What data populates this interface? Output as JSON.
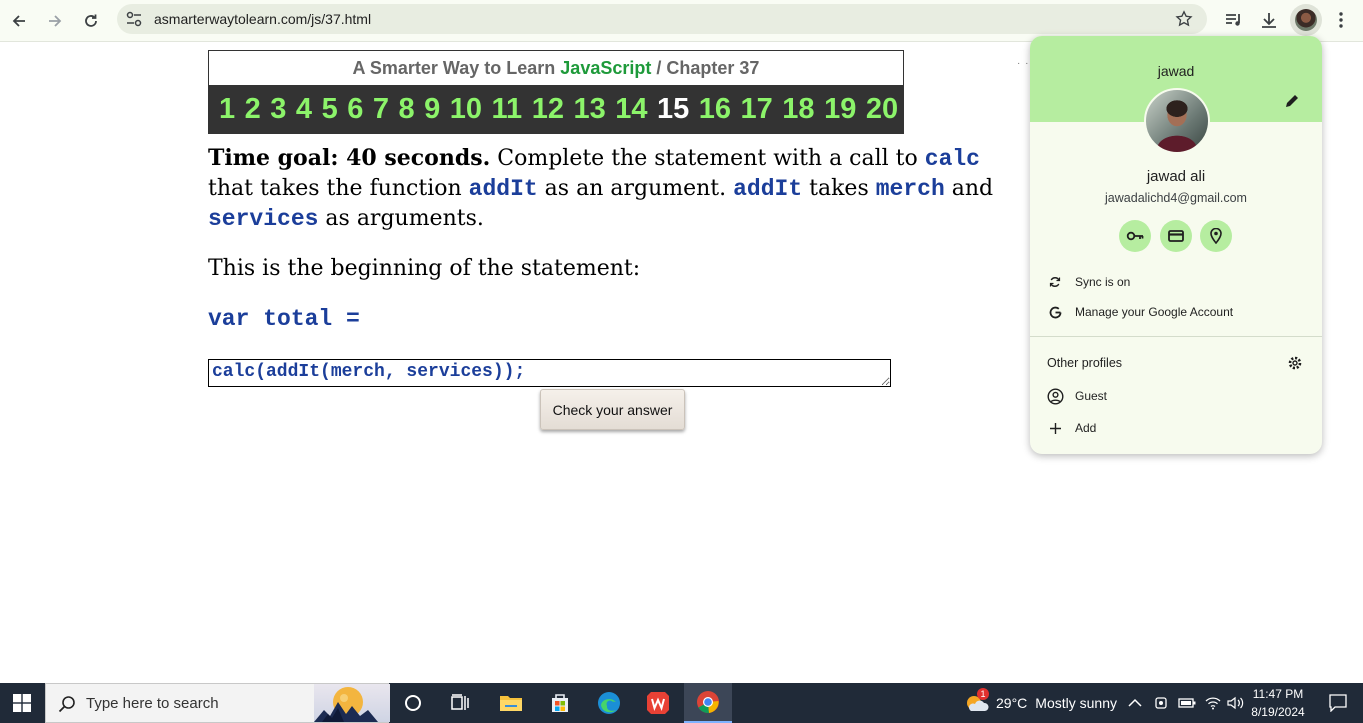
{
  "browser": {
    "url": "asmarterwaytolearn.com/js/37.html"
  },
  "chapter": {
    "prefix": "A Smarter Way to Learn",
    "brand": "JavaScript",
    "separator": "/",
    "chapter_label": "Chapter 37",
    "numbers": [
      "1",
      "2",
      "3",
      "4",
      "5",
      "6",
      "7",
      "8",
      "9",
      "10",
      "11",
      "12",
      "13",
      "14",
      "15",
      "16",
      "17",
      "18",
      "19",
      "20"
    ],
    "current": "15",
    "number_color": "#8cf46a",
    "current_color": "#ffffff"
  },
  "lesson": {
    "goal": "Time goal: 40 seconds.",
    "t1": " Complete the statement with a call to ",
    "c1": "calc",
    "t2": " that takes the function  ",
    "c2": "addIt",
    "t3": " as an argument. ",
    "c3": "addIt",
    "t4": " takes ",
    "c4": "merch",
    "t5": " and ",
    "c5": "services",
    "t6": " as arguments."
  },
  "intro": "This is the beginning of the statement:",
  "code_line": "var total =",
  "answer_value": "calc(addIt(merch, services));",
  "check_button": "Check your answer",
  "profile": {
    "banner_name": "jawad",
    "full_name": "jawad ali",
    "email": "jawadalichd4@gmail.com",
    "quick_actions": [
      "key-icon",
      "card-icon",
      "location-icon"
    ],
    "sync": "Sync is on",
    "manage": "Manage your Google Account",
    "other_profiles": "Other profiles",
    "guest": "Guest",
    "add": "Add",
    "accent": "#b6eda0"
  },
  "taskbar": {
    "search_placeholder": "Type here to search",
    "weather_badge": "1",
    "temperature": "29°C",
    "weather": "Mostly sunny",
    "time": "11:47 PM",
    "date": "8/19/2024"
  }
}
